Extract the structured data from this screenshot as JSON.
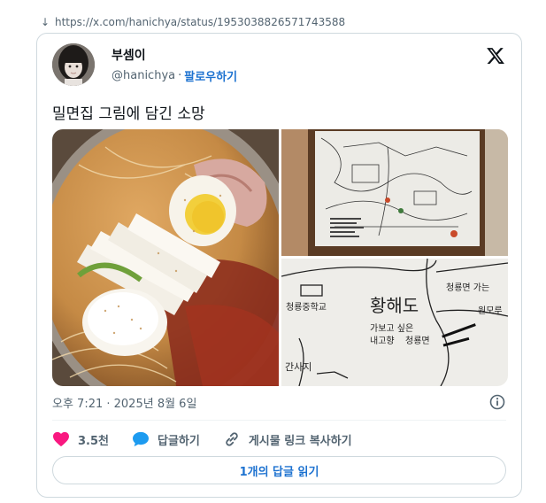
{
  "source_url": "https://x.com/hanichya/status/1953038826571743588",
  "author": {
    "display_name": "부셈이",
    "handle": "@hanichya",
    "separator": "·",
    "follow_label": "팔로우하기"
  },
  "tweet": {
    "text": "밀면집 그림에 담긴 소망",
    "timestamp": "오후 7:21 · 2025년 8월 6일"
  },
  "images": {
    "map_words": {
      "region": "황해도",
      "line1": "가보고 싶은",
      "line2": "내고향",
      "place": "청룡면",
      "school": "청룡중학교",
      "left_place": "간사지",
      "right_place": "청룡면 가는",
      "far_right": "원모루"
    }
  },
  "actions": {
    "like_count": "3.5천",
    "reply_label": "답글하기",
    "copy_link_label": "게시물 링크 복사하기"
  },
  "replies_button": "1개의 답글 읽기",
  "colors": {
    "like": "#f91880",
    "reply": "#1d9bf0",
    "link_blue": "#1d72d0",
    "muted": "#536471",
    "border": "#cfd9de"
  },
  "icons": [
    "download-arrow-icon",
    "x-logo-icon",
    "info-icon",
    "heart-icon",
    "reply-bubble-icon",
    "link-icon"
  ]
}
